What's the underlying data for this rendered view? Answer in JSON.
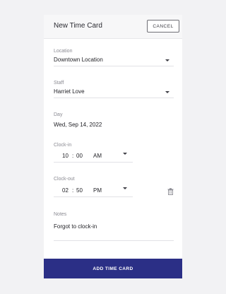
{
  "header": {
    "title": "New Time Card",
    "cancel_label": "CANCEL"
  },
  "location": {
    "label": "Location",
    "value": "Downtown Location"
  },
  "staff": {
    "label": "Staff",
    "value": "Harriet Love"
  },
  "day": {
    "label": "Day",
    "value": "Wed, Sep 14, 2022"
  },
  "clock_in": {
    "label": "Clock-in",
    "hour": "10",
    "sep": ":",
    "minute": "00",
    "period": "AM"
  },
  "clock_out": {
    "label": "Clock-out",
    "hour": "02",
    "sep": ":",
    "minute": "50",
    "period": "PM"
  },
  "notes": {
    "label": "Notes",
    "value": "Forgot to clock-in"
  },
  "submit_label": "ADD TIME CARD",
  "colors": {
    "primary": "#2b2f86",
    "background": "#f2f2f4",
    "card": "#ffffff"
  },
  "icons": {
    "dropdown": "chevron-down-icon",
    "delete": "trash-icon"
  }
}
